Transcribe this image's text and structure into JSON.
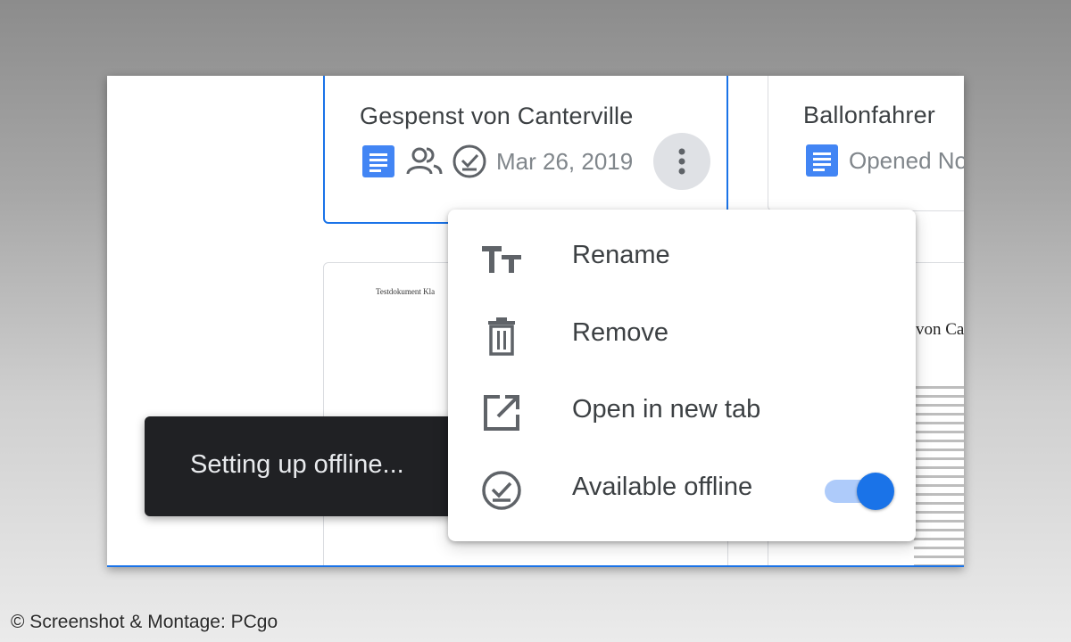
{
  "cards": [
    {
      "title": "Gespenst von Canterville",
      "date": "Mar 26, 2019"
    },
    {
      "title": "Ballonfahrer",
      "opened": "Opened No"
    }
  ],
  "previews": {
    "left_doc_heading": "Testdokument Kla",
    "right_doc_heading": "von Ca"
  },
  "menu": {
    "items": [
      {
        "label": "Rename",
        "icon": "text-format-icon"
      },
      {
        "label": "Remove",
        "icon": "trash-icon"
      },
      {
        "label": "Open in new tab",
        "icon": "open-in-new-icon"
      },
      {
        "label": "Available offline",
        "icon": "offline-check-icon",
        "toggle_on": true
      }
    ]
  },
  "snackbar": {
    "text": "Setting up offline..."
  },
  "credit": "© Screenshot & Montage: PCgo",
  "colors": {
    "accent": "#1a73e8",
    "doc_icon": "#4285f4",
    "snackbar_bg": "#202124",
    "toggle_track": "#aecbfa"
  }
}
